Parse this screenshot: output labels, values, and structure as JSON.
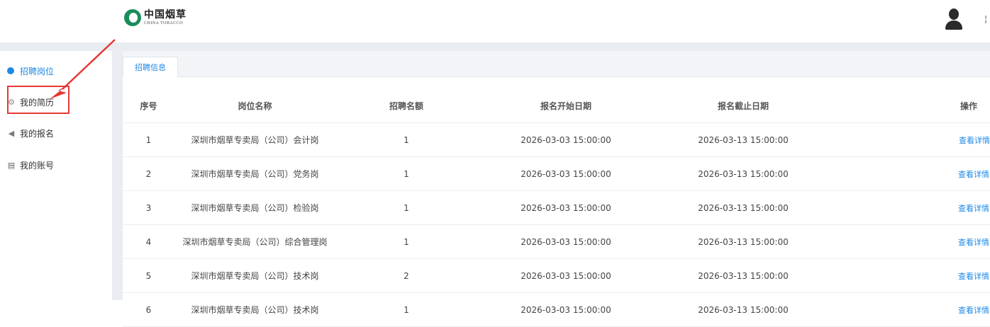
{
  "header": {
    "logo_cn": "中国烟草",
    "logo_en": "CHINA TOBACCO",
    "user_text": "¦"
  },
  "sidebar": {
    "items": [
      {
        "label": "招聘岗位",
        "icon": "circle-check-icon"
      },
      {
        "label": "我的简历",
        "icon": "gear-icon"
      },
      {
        "label": "我的报名",
        "icon": "speaker-icon"
      },
      {
        "label": "我的账号",
        "icon": "id-card-icon"
      }
    ]
  },
  "tabs": [
    {
      "label": "招聘信息"
    }
  ],
  "table": {
    "headers": [
      "序号",
      "岗位名称",
      "招聘名额",
      "报名开始日期",
      "报名截止日期",
      "操作"
    ],
    "rows": [
      {
        "no": "1",
        "name": "深圳市烟草专卖局（公司）会计岗",
        "quota": "1",
        "start": "2026-03-03 15:00:00",
        "end": "2026-03-13 15:00:00",
        "action": "查看详情"
      },
      {
        "no": "2",
        "name": "深圳市烟草专卖局（公司）党务岗",
        "quota": "1",
        "start": "2026-03-03 15:00:00",
        "end": "2026-03-13 15:00:00",
        "action": "查看详情"
      },
      {
        "no": "3",
        "name": "深圳市烟草专卖局（公司）检验岗",
        "quota": "1",
        "start": "2026-03-03 15:00:00",
        "end": "2026-03-13 15:00:00",
        "action": "查看详情"
      },
      {
        "no": "4",
        "name": "深圳市烟草专卖局（公司）综合管理岗",
        "quota": "1",
        "start": "2026-03-03 15:00:00",
        "end": "2026-03-13 15:00:00",
        "action": "查看详情"
      },
      {
        "no": "5",
        "name": "深圳市烟草专卖局（公司）技术岗",
        "quota": "2",
        "start": "2026-03-03 15:00:00",
        "end": "2026-03-13 15:00:00",
        "action": "查看详情"
      },
      {
        "no": "6",
        "name": "深圳市烟草专卖局（公司）技术岗",
        "quota": "1",
        "start": "2026-03-03 15:00:00",
        "end": "2026-03-13 15:00:00",
        "action": "查看详情"
      }
    ]
  },
  "colors": {
    "accent": "#1e88e5",
    "annotation": "#e53935",
    "brand": "#1a8c5a"
  }
}
